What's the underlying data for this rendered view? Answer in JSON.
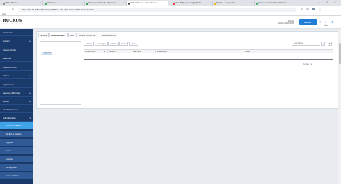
{
  "browser": {
    "tabs": [
      {
        "label": "172.16.255.210",
        "fav": "#888888"
      },
      {
        "label": "VTI Wireless",
        "fav": "#2aa14b"
      },
      {
        "label": "Ruckus SmartZone 5.1 Release N",
        "fav": "#2aa14b"
      },
      {
        "label": "Ruckus Wireless - Virtual Smart Z",
        "fav": "#333333"
      },
      {
        "label": "Inbox (825) - jsaunmey@VRSSS...",
        "fav": "#d93025"
      },
      {
        "label": "My Drive - Google Drive",
        "fav": "#f4b400"
      },
      {
        "label": "Wireless Links WLF/WLF-MIS-Firm",
        "fav": "#2aa14b"
      }
    ],
    "url": "https://172.16.255.210:8443/cwpp/ff8f36ce-a1f4-4695-8eb2-ad69c1c0c1ba/0.0/0.ff/",
    "bookmarks_label": "Apps",
    "window_controls": [
      "–",
      "□",
      "✕"
    ]
  },
  "header": {
    "logo": "RUCKUS",
    "logo_sub": "Virtual SmartZone · High Scale",
    "time_line1": "Wed 11",
    "time_line2": "2019-11-06 10:06:20",
    "default_button": "default ▾",
    "admin_label": "admin"
  },
  "sidebar": {
    "items": [
      {
        "label": "Dashboard",
        "arrow": ""
      },
      {
        "label": "System",
        "arrow": "▸"
      },
      {
        "label": "Access Points",
        "arrow": ""
      },
      {
        "label": "Switches",
        "arrow": ""
      },
      {
        "label": "Wireless LANs",
        "arrow": ""
      },
      {
        "label": "Clients",
        "arrow": "▸"
      },
      {
        "label": "Applications",
        "arrow": ""
      },
      {
        "label": "Services & Profiles",
        "arrow": "▸"
      },
      {
        "label": "Report",
        "arrow": "▸"
      },
      {
        "label": "Troubleshooting",
        "arrow": ""
      },
      {
        "label": "Administration",
        "arrow": "▾"
      }
    ],
    "subitems": [
      {
        "label": "Admins and Roles",
        "active": true
      },
      {
        "label": "Backup & Restore",
        "active": false
      },
      {
        "label": "Upgrade",
        "active": false
      },
      {
        "label": "Admin",
        "active": false
      },
      {
        "label": "Licenses",
        "active": false
      },
      {
        "label": "AP Migration",
        "active": false
      },
      {
        "label": "Admin activities",
        "active": false
      }
    ]
  },
  "main": {
    "tabs": [
      "Groups",
      "Administrators",
      "AAA",
      "Access Control List",
      "Account Security"
    ],
    "active_tab": 1,
    "tree_node": "System",
    "toolbar": {
      "create": "+ Create",
      "configure": "✎ Configure",
      "delete": "✕ Delete",
      "unlock": "Unlock",
      "more": "More ▾"
    },
    "search_placeholder": "search table",
    "columns": [
      "Account Name",
      "Group ID",
      "Real Name",
      "Email Address",
      "Phone"
    ],
    "rows_per_page": "Per Item  1 ▾"
  }
}
